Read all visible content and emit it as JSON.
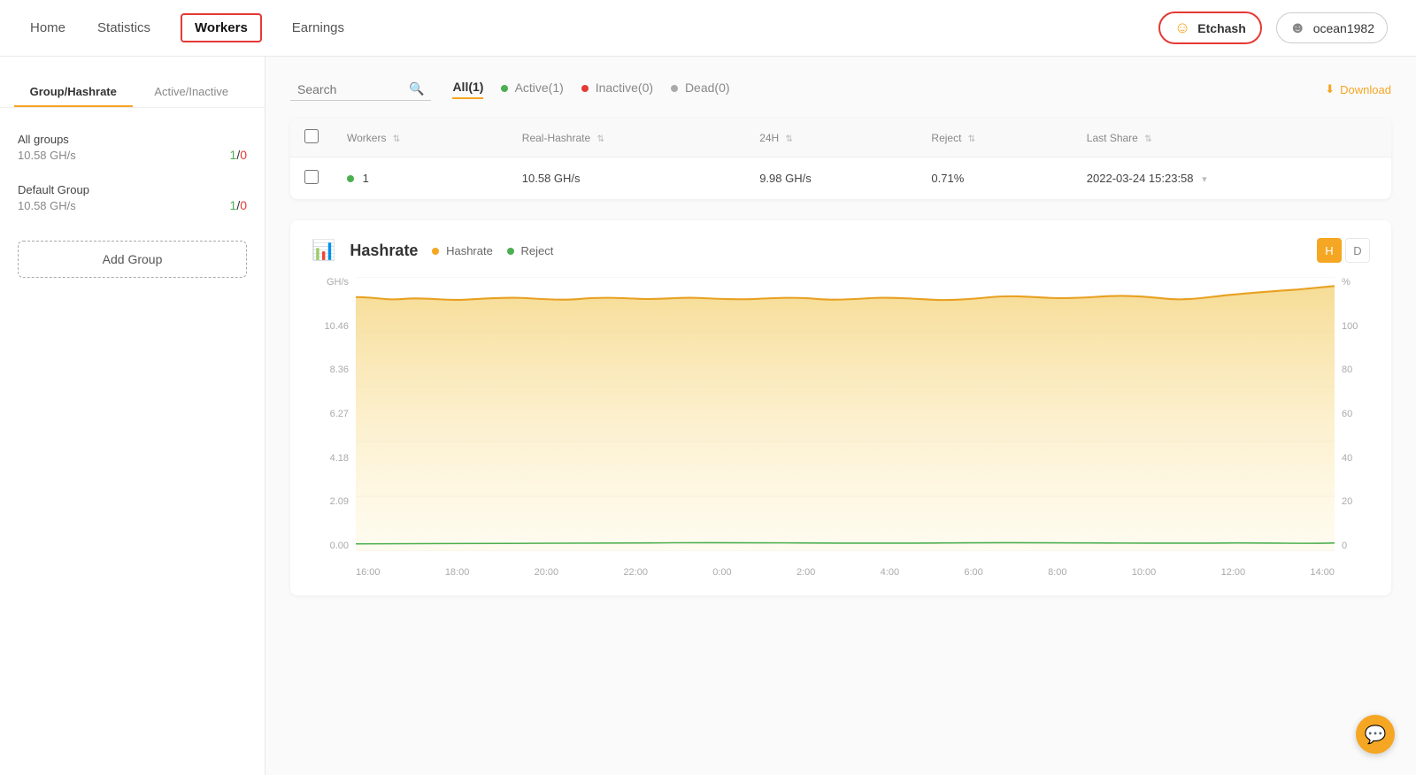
{
  "nav": {
    "items": [
      {
        "label": "Home",
        "id": "home",
        "active": false
      },
      {
        "label": "Statistics",
        "id": "statistics",
        "active": false
      },
      {
        "label": "Workers",
        "id": "workers",
        "active": true
      },
      {
        "label": "Earnings",
        "id": "earnings",
        "active": false
      }
    ],
    "etchash_label": "Etchash",
    "user_label": "ocean1982"
  },
  "sidebar": {
    "tab_group": "Group/Hashrate",
    "tab_status": "Active/Inactive",
    "groups": [
      {
        "name": "All groups",
        "hashrate": "10.58 GH/s",
        "active": 1,
        "inactive": 0
      },
      {
        "name": "Default Group",
        "hashrate": "10.58 GH/s",
        "active": 1,
        "inactive": 0
      }
    ],
    "add_group_label": "Add Group"
  },
  "filters": {
    "search_placeholder": "Search",
    "tabs": [
      {
        "label": "All(1)",
        "id": "all",
        "active": true
      },
      {
        "label": "Active(1)",
        "id": "active",
        "active": false,
        "dot": "green"
      },
      {
        "label": "Inactive(0)",
        "id": "inactive",
        "active": false,
        "dot": "red"
      },
      {
        "label": "Dead(0)",
        "id": "dead",
        "active": false,
        "dot": "gray"
      }
    ],
    "download_label": "Download"
  },
  "table": {
    "columns": [
      {
        "label": "Workers",
        "sortable": true
      },
      {
        "label": "Real-Hashrate",
        "sortable": true
      },
      {
        "label": "24H",
        "sortable": true
      },
      {
        "label": "Reject",
        "sortable": true
      },
      {
        "label": "Last Share",
        "sortable": true
      }
    ],
    "rows": [
      {
        "name": "1",
        "status": "active",
        "real_hashrate": "10.58 GH/s",
        "hashrate_24h": "9.98 GH/s",
        "reject": "0.71%",
        "last_share": "2022-03-24 15:23:58"
      }
    ]
  },
  "chart": {
    "title": "Hashrate",
    "legend_hashrate": "Hashrate",
    "legend_reject": "Reject",
    "time_buttons": [
      "H",
      "D"
    ],
    "active_time": "H",
    "y_left_labels": [
      "10.46",
      "8.36",
      "6.27",
      "4.18",
      "2.09",
      "0.00"
    ],
    "y_right_labels": [
      "100",
      "80",
      "60",
      "40",
      "20",
      "0"
    ],
    "y_left_unit": "GH/s",
    "y_right_unit": "%",
    "x_labels": [
      "16:00",
      "18:00",
      "20:00",
      "22:00",
      "0:00",
      "2:00",
      "4:00",
      "6:00",
      "8:00",
      "10:00",
      "12:00",
      "14:00"
    ]
  }
}
